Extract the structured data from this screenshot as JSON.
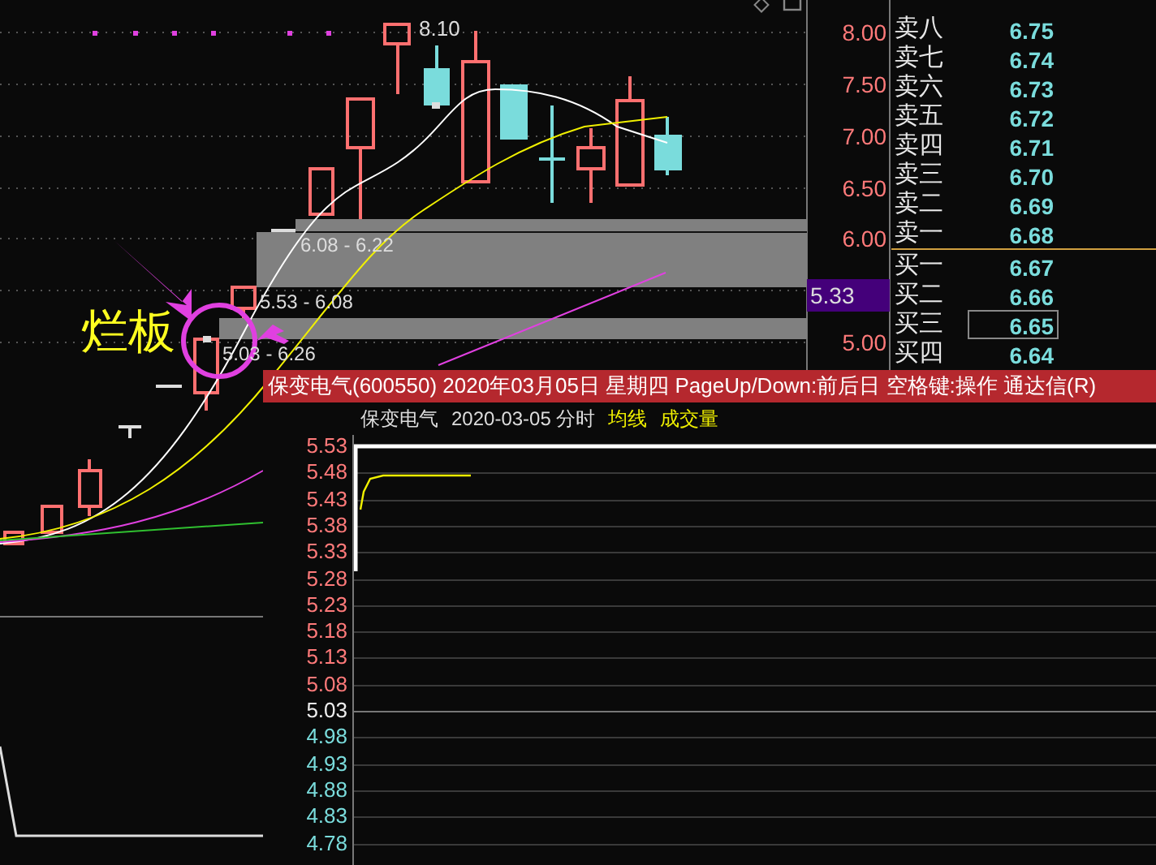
{
  "main_chart": {
    "price_axis": [
      "8.00",
      "7.50",
      "7.00",
      "6.50",
      "6.00",
      "5.00"
    ],
    "current_price_tag": "5.33",
    "high_label": "8.10",
    "zone_labels": [
      "6.08 - 6.22",
      "5.53 - 6.08",
      "5.03 - 6.26"
    ],
    "annotation": "烂板"
  },
  "order_book": {
    "sell": [
      {
        "label": "卖八",
        "price": "6.75",
        "selected": false
      },
      {
        "label": "卖七",
        "price": "6.74",
        "selected": false
      },
      {
        "label": "卖六",
        "price": "6.73",
        "selected": false
      },
      {
        "label": "卖五",
        "price": "6.72",
        "selected": false
      },
      {
        "label": "卖四",
        "price": "6.71",
        "selected": false
      },
      {
        "label": "卖三",
        "price": "6.70",
        "selected": false
      },
      {
        "label": "卖二",
        "price": "6.69",
        "selected": false
      },
      {
        "label": "卖一",
        "price": "6.68",
        "selected": false
      }
    ],
    "buy": [
      {
        "label": "买一",
        "price": "6.67",
        "selected": false
      },
      {
        "label": "买二",
        "price": "6.66",
        "selected": false
      },
      {
        "label": "买三",
        "price": "6.65",
        "selected": true
      },
      {
        "label": "买四",
        "price": "6.64",
        "selected": false
      }
    ]
  },
  "popup": {
    "title": "保变电气(600550) 2020年03月05日 星期四 PageUp/Down:前后日 空格键:操作 通达信(R)",
    "header": [
      {
        "text": "保变电气",
        "kind": "plain"
      },
      {
        "text": "2020-03-05 分时",
        "kind": "plain"
      },
      {
        "text": "均线",
        "kind": "legend"
      },
      {
        "text": "成交量",
        "kind": "legend"
      }
    ],
    "price_axis": [
      {
        "text": "5.53",
        "kind": "up"
      },
      {
        "text": "5.48",
        "kind": "up"
      },
      {
        "text": "5.43",
        "kind": "up"
      },
      {
        "text": "5.38",
        "kind": "up"
      },
      {
        "text": "5.33",
        "kind": "up"
      },
      {
        "text": "5.28",
        "kind": "up"
      },
      {
        "text": "5.23",
        "kind": "up"
      },
      {
        "text": "5.18",
        "kind": "up"
      },
      {
        "text": "5.13",
        "kind": "up"
      },
      {
        "text": "5.08",
        "kind": "up"
      },
      {
        "text": "5.03",
        "kind": "flat"
      },
      {
        "text": "4.98",
        "kind": "down"
      },
      {
        "text": "4.93",
        "kind": "down"
      },
      {
        "text": "4.88",
        "kind": "down"
      },
      {
        "text": "4.83",
        "kind": "down"
      },
      {
        "text": "4.78",
        "kind": "down"
      }
    ]
  }
}
